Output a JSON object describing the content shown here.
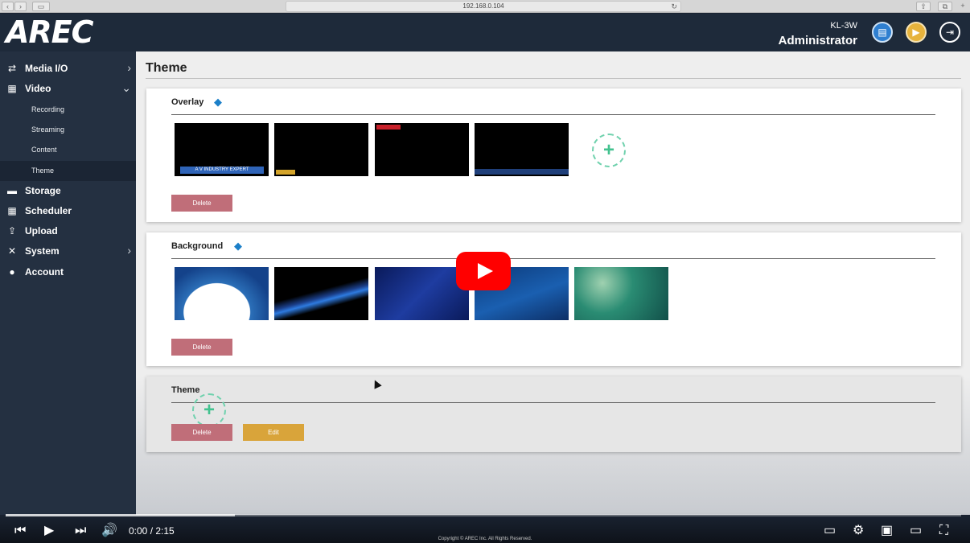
{
  "browser": {
    "url": "192.168.0.104"
  },
  "header": {
    "logo": "AREC",
    "model": "KL-3W",
    "user": "Administrator"
  },
  "sidebar": {
    "items": [
      {
        "label": "Media I/O"
      },
      {
        "label": "Video"
      },
      {
        "label": "Storage"
      },
      {
        "label": "Scheduler"
      },
      {
        "label": "Upload"
      },
      {
        "label": "System"
      },
      {
        "label": "Account"
      }
    ],
    "video_sub": [
      {
        "label": "Recording"
      },
      {
        "label": "Streaming"
      },
      {
        "label": "Content"
      },
      {
        "label": "Theme"
      }
    ]
  },
  "main": {
    "page_title": "Theme",
    "overlay": {
      "title": "Overlay",
      "thumb1_text": "A V INDUSTRY EXPERT",
      "delete_label": "Delete"
    },
    "background": {
      "title": "Background",
      "delete_label": "Delete"
    },
    "theme": {
      "title": "Theme",
      "delete_label": "Delete",
      "edit_label": "Edit"
    }
  },
  "player": {
    "time": "0:00 / 2:15",
    "progress_loaded": 0.24
  },
  "footer": {
    "copyright": "Copyright © AREC Inc. All Rights Reserved."
  }
}
